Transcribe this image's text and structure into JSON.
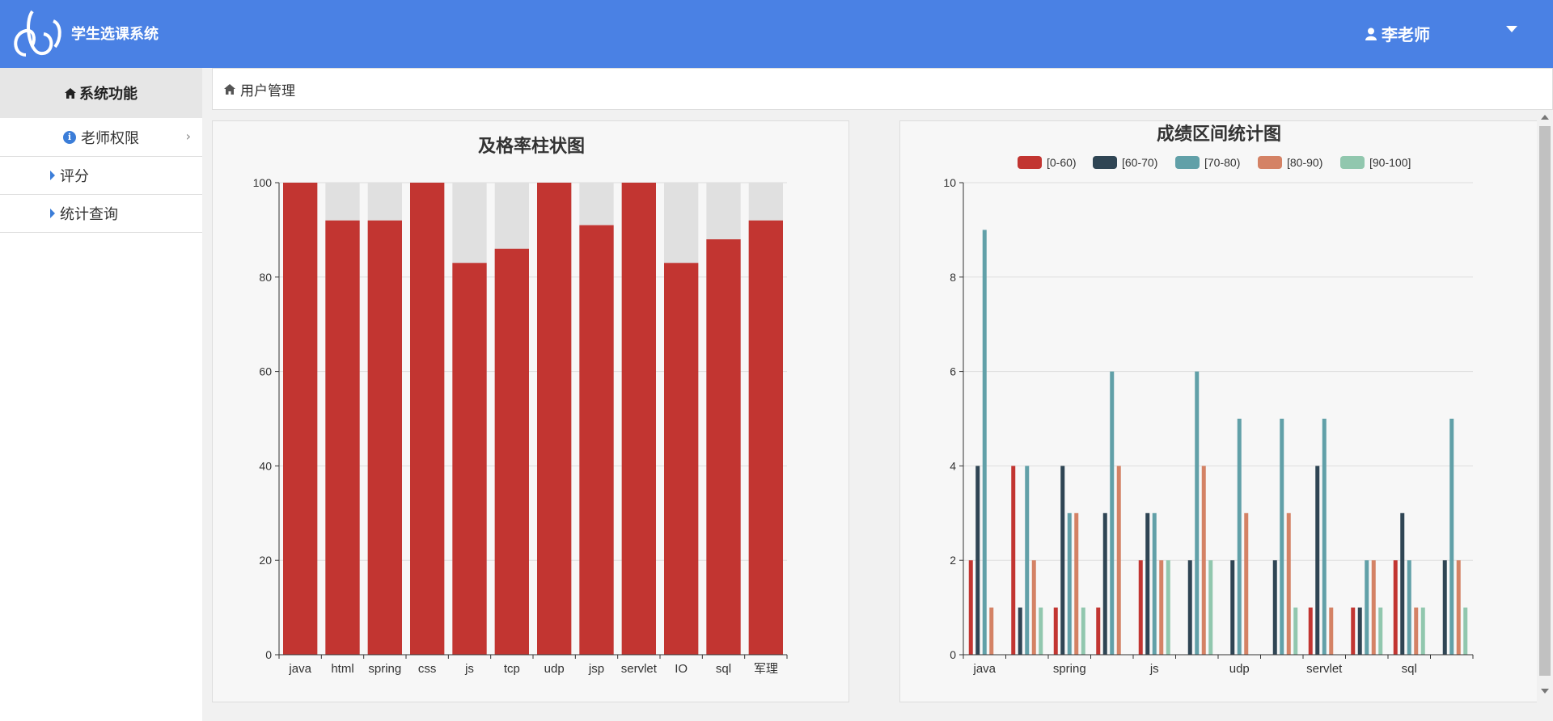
{
  "app": {
    "title": "学生选课系统",
    "user_name": "李老师"
  },
  "sidebar": {
    "header": "系统功能",
    "group": {
      "label": "老师权限"
    },
    "items": [
      {
        "label": "评分"
      },
      {
        "label": "统计查询"
      }
    ]
  },
  "breadcrumb": {
    "label": "用户管理"
  },
  "icons": {
    "home": "home-icon",
    "user": "user-icon",
    "info": "info-icon",
    "caret": "caret-down-icon"
  },
  "colors": {
    "header_bg": "#4a81e4",
    "bar_red": "#c23531",
    "bar_bg": "#e0e0e0"
  },
  "chart_data": [
    {
      "type": "bar",
      "title": "及格率柱状图",
      "categories": [
        "java",
        "html",
        "spring",
        "css",
        "js",
        "tcp",
        "udp",
        "jsp",
        "servlet",
        "IO",
        "sql",
        "军理"
      ],
      "values": [
        100,
        92,
        92,
        100,
        83,
        86,
        100,
        91,
        100,
        83,
        88,
        92
      ],
      "ylim": [
        0,
        100
      ],
      "yticks": [
        0,
        20,
        40,
        60,
        80,
        100
      ],
      "background_bar_max": 100,
      "grid": true
    },
    {
      "type": "bar",
      "title": "成绩区间统计图",
      "legend_position": "top",
      "categories": [
        "java",
        "html",
        "spring",
        "css",
        "js",
        "tcp",
        "udp",
        "jsp",
        "servlet",
        "IO",
        "sql",
        "军理"
      ],
      "xtick_labels_shown": [
        "java",
        "",
        "spring",
        "",
        "js",
        "",
        "udp",
        "",
        "servlet",
        "",
        "sql",
        ""
      ],
      "series": [
        {
          "name": "[0-60)",
          "color": "#c23531",
          "values": [
            2,
            4,
            1,
            1,
            2,
            0,
            0,
            0,
            1,
            1,
            2,
            0
          ]
        },
        {
          "name": "[60-70)",
          "color": "#2f4554",
          "values": [
            4,
            1,
            4,
            3,
            3,
            2,
            2,
            2,
            4,
            1,
            3,
            2
          ]
        },
        {
          "name": "[70-80)",
          "color": "#61a0a8",
          "values": [
            9,
            4,
            3,
            6,
            3,
            6,
            5,
            5,
            5,
            2,
            2,
            5
          ]
        },
        {
          "name": "[80-90)",
          "color": "#d48265",
          "values": [
            1,
            2,
            3,
            4,
            2,
            4,
            3,
            3,
            1,
            2,
            1,
            2
          ]
        },
        {
          "name": "[90-100]",
          "color": "#91c7ae",
          "values": [
            0,
            1,
            1,
            0,
            2,
            2,
            0,
            1,
            0,
            1,
            1,
            1
          ]
        }
      ],
      "ylim": [
        0,
        10
      ],
      "yticks": [
        0,
        2,
        4,
        6,
        8,
        10
      ],
      "grid": true
    }
  ]
}
